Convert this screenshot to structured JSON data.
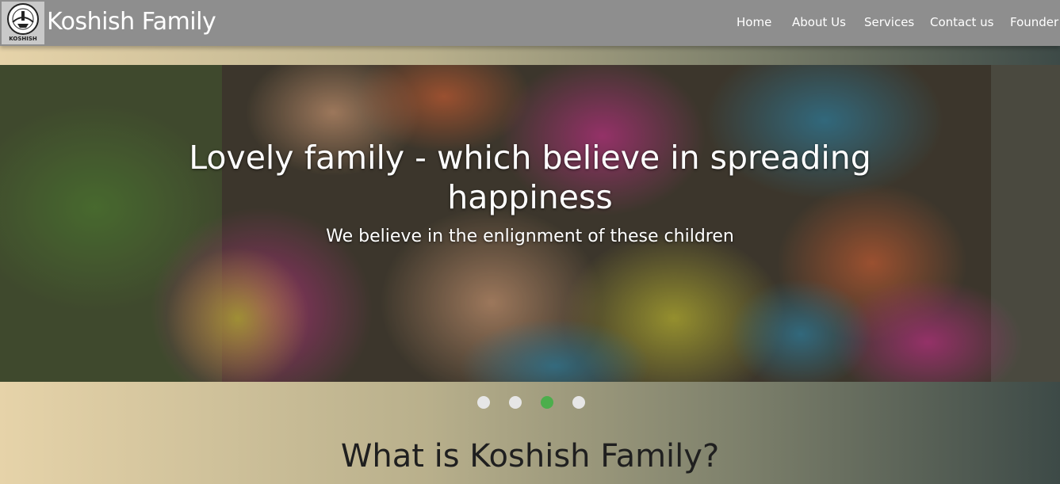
{
  "brand": {
    "name": "Koshish Family",
    "logo_text": "KOSHISH"
  },
  "nav": {
    "items": [
      "Home",
      "About Us",
      "Services",
      "Contact us",
      "Founder"
    ]
  },
  "hero": {
    "title": "Lovely family - which believe in spreading happiness",
    "subtitle": "We believe in the enlignment of these children"
  },
  "carousel": {
    "slide_count": 4,
    "active_index": 2,
    "active_color": "#4cae4c",
    "inactive_color": "#e6e6e6"
  },
  "section": {
    "heading": "What is Koshish Family?"
  },
  "colors": {
    "navbar": "#8e8e8e",
    "text_light": "#ffffff"
  }
}
